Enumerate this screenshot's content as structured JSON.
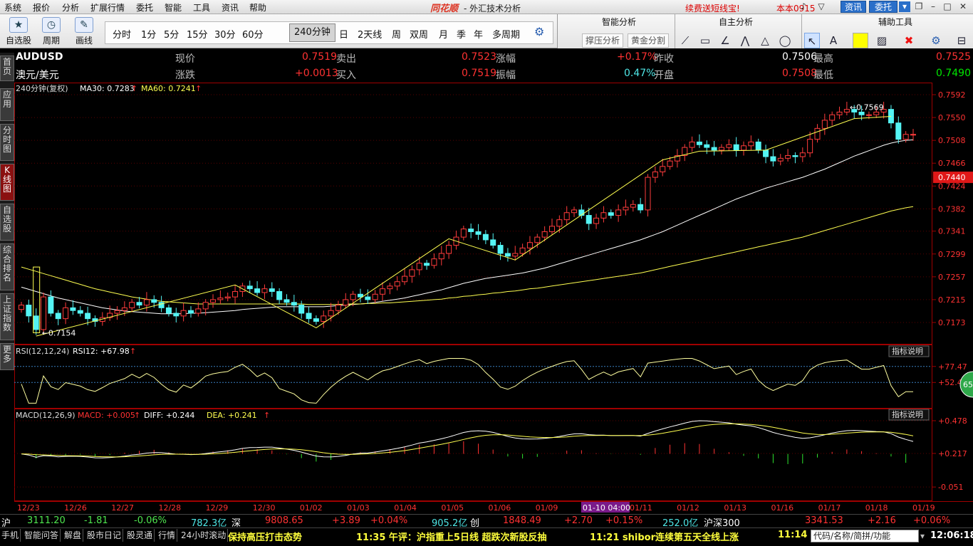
{
  "menu": {
    "items": [
      "系统",
      "报价",
      "分析",
      "扩展行情",
      "委托",
      "智能",
      "工具",
      "资讯",
      "帮助"
    ],
    "app_logo": "同花顺",
    "app_subtitle": "- 外汇技术分析",
    "promo": "续费送短线宝!",
    "version": "本本0915",
    "btn_news": "资讯",
    "btn_trade": "委托"
  },
  "toolbar": {
    "big_buttons": [
      {
        "label": "自选股",
        "icon": "star-icon"
      },
      {
        "label": "周期",
        "icon": "clock-icon"
      },
      {
        "label": "画线",
        "icon": "pencil-icon"
      }
    ],
    "periods": [
      "分时",
      "1分",
      "5分",
      "15分",
      "30分",
      "60分",
      "240分钟",
      "日",
      "2天线",
      "周",
      "双周",
      "月",
      "季",
      "年",
      "多周期"
    ],
    "active_period": "240分钟",
    "settings_icon": "gear-icon"
  },
  "panels": {
    "smart": {
      "title": "智能分析",
      "buttons": [
        "撑压分析",
        "黄金分割"
      ]
    },
    "own": {
      "title": "自主分析"
    },
    "aux": {
      "title": "辅助工具"
    },
    "highlight_color": "#ffff00"
  },
  "sidetabs": [
    "首页",
    "应用",
    "分时图",
    "K线图",
    "自选股",
    "综合排名",
    "上证指数",
    "更多"
  ],
  "sidetab_active": "K线图",
  "info": {
    "symbol": "AUDUSD",
    "name": "澳元/美元",
    "row1": [
      {
        "label": "现价",
        "value": "0.7519"
      },
      {
        "label": "卖出",
        "value": "0.7523"
      },
      {
        "label": "涨幅",
        "value": "+0.17%"
      },
      {
        "label": "昨收",
        "value": "0.7506"
      },
      {
        "label": "最高",
        "value": "0.7525"
      }
    ],
    "row2": [
      {
        "label": "涨跌",
        "value": "+0.0013"
      },
      {
        "label": "买入",
        "value": "0.7519"
      },
      {
        "label": "振幅",
        "value": "0.47%"
      },
      {
        "label": "开盘",
        "value": "0.7508"
      },
      {
        "label": "最低",
        "value": "0.7490"
      }
    ],
    "indicator_line": "240分钟(复权)",
    "ma30": "MA30: 0.7283",
    "ma60": "MA60: 0.7241"
  },
  "chart_data": {
    "type": "candlestick",
    "price_ticks": [
      "0.7592",
      "0.7550",
      "0.7508",
      "0.7466",
      "0.7424",
      "0.7382",
      "0.7341",
      "0.7299",
      "0.7257",
      "0.7215",
      "0.7173"
    ],
    "current_price_label": "0.7440",
    "annotations": {
      "low": "0.7154",
      "high": "0.7569"
    },
    "rsi": {
      "title": "RSI(12,12,24)",
      "value": "RSI12: +67.98",
      "ticks": [
        "+77.47",
        "+52.47"
      ],
      "button": "指标说明",
      "circle_value": "65"
    },
    "macd": {
      "title": "MACD(12,26,9)",
      "macd": "MACD: +0.005",
      "diff": "DIFF: +0.244",
      "dea": "DEA: +0.241",
      "ticks": [
        "+0.478",
        "+0.217",
        "-0.051"
      ],
      "button": "指标说明"
    },
    "date_labels": [
      "12/23",
      "12/26",
      "12/27",
      "12/28",
      "12/29",
      "12/30",
      "01/02",
      "01/03",
      "01/04",
      "01/05",
      "01/06",
      "01/09",
      "01-10 04:00",
      "01/11",
      "01/12",
      "01/13",
      "01/16",
      "01/17",
      "01/18",
      "01/19"
    ],
    "highlighted_date": "01-10 04:00",
    "close": [
      0.7205,
      0.7185,
      0.716,
      0.722,
      0.719,
      0.718,
      0.72,
      0.7195,
      0.719,
      0.718,
      0.7175,
      0.7182,
      0.719,
      0.7195,
      0.72,
      0.721,
      0.7205,
      0.7215,
      0.721,
      0.72,
      0.719,
      0.7185,
      0.7195,
      0.719,
      0.7198,
      0.721,
      0.7215,
      0.7218,
      0.722,
      0.723,
      0.724,
      0.7235,
      0.7228,
      0.7235,
      0.723,
      0.7215,
      0.721,
      0.7205,
      0.719,
      0.718,
      0.7175,
      0.7185,
      0.7195,
      0.7205,
      0.7215,
      0.7225,
      0.722,
      0.7215,
      0.7225,
      0.7235,
      0.724,
      0.7248,
      0.7258,
      0.727,
      0.7282,
      0.7278,
      0.729,
      0.73,
      0.7315,
      0.733,
      0.7345,
      0.734,
      0.7335,
      0.7325,
      0.7315,
      0.73,
      0.7295,
      0.73,
      0.731,
      0.732,
      0.733,
      0.734,
      0.735,
      0.7362,
      0.7375,
      0.738,
      0.737,
      0.7355,
      0.7365,
      0.7375,
      0.737,
      0.738,
      0.7385,
      0.739,
      0.738,
      0.744,
      0.745,
      0.746,
      0.747,
      0.748,
      0.7495,
      0.7505,
      0.75,
      0.7495,
      0.749,
      0.7495,
      0.75,
      0.749,
      0.7498,
      0.7505,
      0.749,
      0.7478,
      0.747,
      0.7475,
      0.748,
      0.7478,
      0.7485,
      0.751,
      0.753,
      0.7545,
      0.7555,
      0.756,
      0.7565,
      0.756,
      0.7555,
      0.7555,
      0.756,
      0.7565,
      0.754,
      0.751,
      0.7519,
      0.7519
    ],
    "ma30": [
      0.7238,
      0.7234,
      0.723,
      0.7226,
      0.7222,
      0.7218,
      0.7215,
      0.7212,
      0.7209,
      0.7206,
      0.7203,
      0.72,
      0.7198,
      0.7196,
      0.7194,
      0.7193,
      0.7192,
      0.7191,
      0.719,
      0.7189,
      0.7189,
      0.7189,
      0.7189,
      0.719,
      0.719,
      0.7191,
      0.7192,
      0.7193,
      0.7194,
      0.7195,
      0.7197,
      0.7198,
      0.7199,
      0.72,
      0.7201,
      0.7202,
      0.7202,
      0.7202,
      0.7202,
      0.7202,
      0.7202,
      0.7202,
      0.7203,
      0.7204,
      0.7205,
      0.7206,
      0.7207,
      0.7208,
      0.721,
      0.7212,
      0.7214,
      0.7216,
      0.7218,
      0.7221,
      0.7224,
      0.7227,
      0.723,
      0.7233,
      0.7237,
      0.7241,
      0.7245,
      0.7248,
      0.7251,
      0.7254,
      0.7256,
      0.7258,
      0.726,
      0.7262,
      0.7264,
      0.7267,
      0.727,
      0.7273,
      0.7277,
      0.7281,
      0.7285,
      0.7289,
      0.7293,
      0.7297,
      0.7301,
      0.7305,
      0.7309,
      0.7313,
      0.7317,
      0.7321,
      0.7325,
      0.733,
      0.7335,
      0.734,
      0.7346,
      0.7352,
      0.7358,
      0.7364,
      0.737,
      0.7376,
      0.7382,
      0.7388,
      0.7394,
      0.74,
      0.7405,
      0.741,
      0.7415,
      0.742,
      0.7424,
      0.7428,
      0.7432,
      0.7436,
      0.744,
      0.7445,
      0.745,
      0.7455,
      0.7461,
      0.7467,
      0.7473,
      0.7479,
      0.7484,
      0.7489,
      0.7494,
      0.7499,
      0.7503,
      0.7506,
      0.7508,
      0.7509
    ],
    "ma60": [
      0.7275,
      0.7271,
      0.7267,
      0.7263,
      0.7259,
      0.7255,
      0.7251,
      0.7247,
      0.7243,
      0.7239,
      0.7235,
      0.7232,
      0.7229,
      0.7226,
      0.7223,
      0.722,
      0.7218,
      0.7216,
      0.7214,
      0.7212,
      0.7211,
      0.721,
      0.7209,
      0.7208,
      0.7207,
      0.7207,
      0.7207,
      0.7207,
      0.7207,
      0.7207,
      0.7207,
      0.7207,
      0.7207,
      0.7207,
      0.7207,
      0.7207,
      0.7207,
      0.7207,
      0.7207,
      0.7206,
      0.7206,
      0.7206,
      0.7206,
      0.7206,
      0.7207,
      0.7207,
      0.7207,
      0.7208,
      0.7208,
      0.7209,
      0.7209,
      0.721,
      0.7211,
      0.7212,
      0.7213,
      0.7214,
      0.7215,
      0.7216,
      0.7218,
      0.7219,
      0.7221,
      0.7222,
      0.7224,
      0.7225,
      0.7227,
      0.7228,
      0.723,
      0.7231,
      0.7233,
      0.7235,
      0.7236,
      0.7238,
      0.724,
      0.7242,
      0.7244,
      0.7246,
      0.7248,
      0.725,
      0.7252,
      0.7254,
      0.7256,
      0.7258,
      0.726,
      0.7262,
      0.7264,
      0.7267,
      0.727,
      0.7273,
      0.7276,
      0.7279,
      0.7282,
      0.7285,
      0.7288,
      0.7291,
      0.7294,
      0.7297,
      0.73,
      0.7303,
      0.7306,
      0.7309,
      0.7312,
      0.7315,
      0.7318,
      0.7321,
      0.7324,
      0.7327,
      0.733,
      0.7334,
      0.7338,
      0.7342,
      0.7346,
      0.735,
      0.7354,
      0.7358,
      0.7362,
      0.7366,
      0.737,
      0.7374,
      0.7378,
      0.7381,
      0.7384,
      0.7386
    ]
  },
  "status": {
    "row1": [
      {
        "text": "沪",
        "color": "#ffffff"
      },
      {
        "text": "3111.20",
        "color": "#4ee64e"
      },
      {
        "text": "-1.81",
        "color": "#4ee64e"
      },
      {
        "text": "-0.06%",
        "color": "#4ee64e"
      },
      {
        "text": "782.3亿",
        "color": "#4ee6e6"
      },
      {
        "text": "深",
        "color": "#ffffff"
      },
      {
        "text": "9808.65",
        "color": "#ff3232"
      },
      {
        "text": "+3.89",
        "color": "#ff3232"
      },
      {
        "text": "+0.04%",
        "color": "#ff3232"
      },
      {
        "text": "905.2亿",
        "color": "#4ee6e6"
      },
      {
        "text": "创",
        "color": "#ffffff"
      },
      {
        "text": "1848.49",
        "color": "#ff3232"
      },
      {
        "text": "+2.70",
        "color": "#ff3232"
      },
      {
        "text": "+0.15%",
        "color": "#ff3232"
      },
      {
        "text": "252.0亿",
        "color": "#4ee6e6"
      },
      {
        "text": "沪深300",
        "color": "#ffffff"
      },
      {
        "text": "3341.53",
        "color": "#ff3232"
      },
      {
        "text": "+2.16",
        "color": "#ff3232"
      },
      {
        "text": "+0.06%",
        "color": "#ff3232"
      }
    ],
    "tabs": [
      "手机",
      "智能问答",
      "解盘",
      "股市日记",
      "股灵通",
      "行情",
      "24小时滚动"
    ],
    "news": [
      "保持高压打击态势",
      "11:35 午评：沪指重上5日线 超跌次新股反抽",
      "11:21 shibor连续第五天全线上涨",
      "11:14"
    ],
    "search_placeholder": "代码/名称/简拼/功能",
    "clock": "12:06:18"
  }
}
